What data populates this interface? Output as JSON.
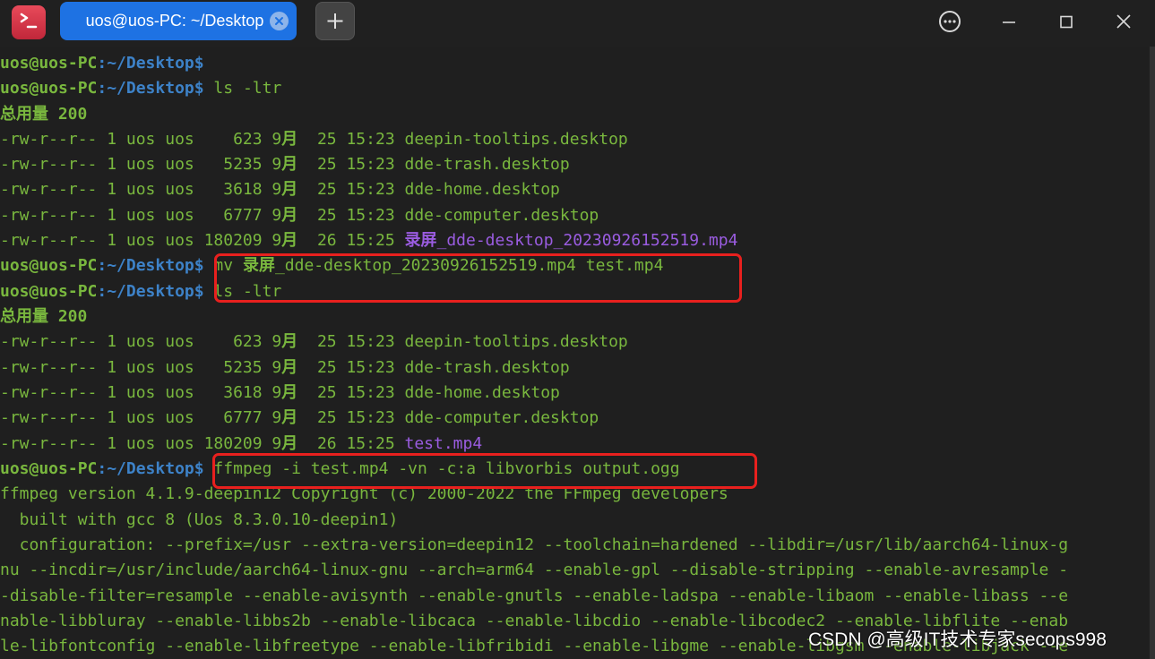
{
  "tab": {
    "title": "uos@uos-PC: ~/Desktop"
  },
  "icons": {
    "app": "terminal-icon",
    "tab_close": "close-circle-icon",
    "new_tab": "plus-icon",
    "menu": "more-circle-icon",
    "minimize": "minimize-icon",
    "maximize": "maximize-icon",
    "close": "close-icon"
  },
  "colors": {
    "text": "#79b73e",
    "path": "#3d82c8",
    "video_file": "#9a5ce0",
    "tab": "#1e72e3",
    "highlight": "#e8201e"
  },
  "terminal": {
    "prompt_user": "uos@uos-PC",
    "prompt_path": ":~/Desktop$",
    "lines": [
      {
        "cmd": ""
      },
      {
        "cmd": " ls -ltr"
      },
      {
        "total_label": "总用量",
        "total_value": " 200"
      },
      {
        "meta": "-rw-r--r-- 1 uos uos    623 9",
        "month": "月",
        "date": "  25 15:23 ",
        "name": "deepin-tooltips.desktop"
      },
      {
        "meta": "-rw-r--r-- 1 uos uos   5235 9",
        "month": "月",
        "date": "  25 15:23 ",
        "name": "dde-trash.desktop"
      },
      {
        "meta": "-rw-r--r-- 1 uos uos   3618 9",
        "month": "月",
        "date": "  25 15:23 ",
        "name": "dde-home.desktop"
      },
      {
        "meta": "-rw-r--r-- 1 uos uos   6777 9",
        "month": "月",
        "date": "  25 15:23 ",
        "name": "dde-computer.desktop"
      },
      {
        "meta": "-rw-r--r-- 1 uos uos 180209 9",
        "month": "月",
        "date": "  26 15:25 ",
        "name_cjk": "录屏",
        "name": "_dde-desktop_20230926152519.mp4"
      },
      {
        "cmd_pre": " mv ",
        "cmd_cjk": "录屏",
        "cmd": "_dde-desktop_20230926152519.mp4 test.mp4"
      },
      {
        "cmd": " ls -ltr"
      },
      {
        "total_label": "总用量",
        "total_value": " 200"
      },
      {
        "meta": "-rw-r--r-- 1 uos uos    623 9",
        "month": "月",
        "date": "  25 15:23 ",
        "name": "deepin-tooltips.desktop"
      },
      {
        "meta": "-rw-r--r-- 1 uos uos   5235 9",
        "month": "月",
        "date": "  25 15:23 ",
        "name": "dde-trash.desktop"
      },
      {
        "meta": "-rw-r--r-- 1 uos uos   3618 9",
        "month": "月",
        "date": "  25 15:23 ",
        "name": "dde-home.desktop"
      },
      {
        "meta": "-rw-r--r-- 1 uos uos   6777 9",
        "month": "月",
        "date": "  25 15:23 ",
        "name": "dde-computer.desktop"
      },
      {
        "meta": "-rw-r--r-- 1 uos uos 180209 9",
        "month": "月",
        "date": "  26 15:25 ",
        "name": "test.mp4"
      },
      {
        "cmd": " ffmpeg -i test.mp4 -vn -c:a libvorbis output.ogg"
      },
      {
        "text": "ffmpeg version 4.1.9-deepin12 Copyright (c) 2000-2022 the FFmpeg developers"
      },
      {
        "text": "  built with gcc 8 (Uos 8.3.0.10-deepin1)"
      },
      {
        "text": "  configuration: --prefix=/usr --extra-version=deepin12 --toolchain=hardened --libdir=/usr/lib/aarch64-linux-g"
      },
      {
        "text": "nu --incdir=/usr/include/aarch64-linux-gnu --arch=arm64 --enable-gpl --disable-stripping --enable-avresample -"
      },
      {
        "text": "-disable-filter=resample --enable-avisynth --enable-gnutls --enable-ladspa --enable-libaom --enable-libass --e"
      },
      {
        "text": "nable-libbluray --enable-libbs2b --enable-libcaca --enable-libcdio --enable-libcodec2 --enable-libflite --enab"
      },
      {
        "text": "le-libfontconfig --enable-libfreetype --enable-libfribidi --enable-libgme --enable-libgsm --enable-libjack --e"
      }
    ]
  },
  "watermark": "CSDN @高级IT技术专家secops998"
}
